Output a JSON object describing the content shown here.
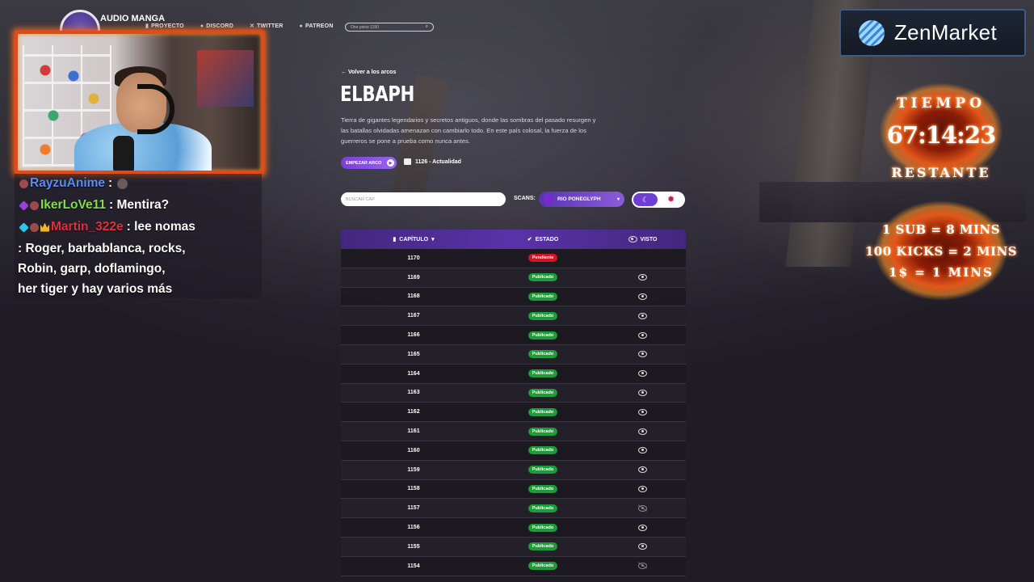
{
  "nav": {
    "logo": "AUDIO MANGA",
    "items": [
      {
        "label": "PROYECTO",
        "icon": "book-icon"
      },
      {
        "label": "DISCORD",
        "icon": "discord-icon"
      },
      {
        "label": "TWITTER",
        "icon": "x-icon"
      },
      {
        "label": "PATREON",
        "icon": "patreon-icon"
      }
    ],
    "search_value": "One piece 1150"
  },
  "chat": {
    "lines": [
      {
        "user": "RayzuAnime",
        "user_color": "#5b8df0",
        "message": ":"
      },
      {
        "user": "IkerLoVe11",
        "user_color": "#7fe04a",
        "message": ": Mentira?"
      },
      {
        "user": "Martin_322e",
        "user_color": "#e0303f",
        "message": ": lee nomas"
      },
      {
        "user": "",
        "user_color": "#ffffff",
        "message": ": Roger, barbablanca, rocks,"
      },
      {
        "user": "",
        "user_color": "#ffffff",
        "message": "Robin, garp, doflamingo,"
      },
      {
        "user": "",
        "user_color": "#ffffff",
        "message": "her tiger y hay varios más"
      }
    ]
  },
  "arc": {
    "back": "← Volver a los arcos",
    "title": "ELBAPH",
    "description": "Tierra de gigantes legendarios y secretos antiguos, donde las sombras del pasado resurgen y las batallas olvidadas amenazan con cambiarlo todo. En este país colosal, la fuerza de los guerreros se pone a prueba como nunca antes.",
    "start_button": "EMPEZAR ARCO",
    "range": "1126 - Actualidad"
  },
  "filters": {
    "search_placeholder": "BUSCAR CAP",
    "scans_label": "SCANS:",
    "scans_value": "RIO PONEGLYPH"
  },
  "table": {
    "headers": {
      "chapter": "CAPÍTULO",
      "status": "ESTADO",
      "seen": "VISTO"
    },
    "rows": [
      {
        "chapter": "1170",
        "status": "Pendiente",
        "status_color": "#d0142a",
        "seen": "none"
      },
      {
        "chapter": "1169",
        "status": "Publicado",
        "status_color": "#1f9b3a",
        "seen": "eye-icon"
      },
      {
        "chapter": "1168",
        "status": "Publicado",
        "status_color": "#1f9b3a",
        "seen": "eye-icon"
      },
      {
        "chapter": "1167",
        "status": "Publicado",
        "status_color": "#1f9b3a",
        "seen": "eye-icon"
      },
      {
        "chapter": "1166",
        "status": "Publicado",
        "status_color": "#1f9b3a",
        "seen": "eye-icon"
      },
      {
        "chapter": "1165",
        "status": "Publicado",
        "status_color": "#1f9b3a",
        "seen": "eye-icon"
      },
      {
        "chapter": "1164",
        "status": "Publicado",
        "status_color": "#1f9b3a",
        "seen": "eye-icon"
      },
      {
        "chapter": "1163",
        "status": "Publicado",
        "status_color": "#1f9b3a",
        "seen": "eye-icon"
      },
      {
        "chapter": "1162",
        "status": "Publicado",
        "status_color": "#1f9b3a",
        "seen": "eye-icon"
      },
      {
        "chapter": "1161",
        "status": "Publicado",
        "status_color": "#1f9b3a",
        "seen": "eye-icon"
      },
      {
        "chapter": "1160",
        "status": "Publicado",
        "status_color": "#1f9b3a",
        "seen": "eye-icon"
      },
      {
        "chapter": "1159",
        "status": "Publicado",
        "status_color": "#1f9b3a",
        "seen": "eye-icon"
      },
      {
        "chapter": "1158",
        "status": "Publicado",
        "status_color": "#1f9b3a",
        "seen": "eye-icon"
      },
      {
        "chapter": "1157",
        "status": "Publicado",
        "status_color": "#1f9b3a",
        "seen": "eye-off-icon"
      },
      {
        "chapter": "1156",
        "status": "Publicado",
        "status_color": "#1f9b3a",
        "seen": "eye-icon"
      },
      {
        "chapter": "1155",
        "status": "Publicado",
        "status_color": "#1f9b3a",
        "seen": "eye-icon"
      },
      {
        "chapter": "1154",
        "status": "Publicado",
        "status_color": "#1f9b3a",
        "seen": "eye-off-icon"
      }
    ]
  },
  "overlay": {
    "sponsor": "ZenMarket",
    "timer_label": "TIEMPO",
    "timer_value": "67:14:23",
    "timer_sub": "RESTANTE",
    "rules": [
      "1 SUB = 8 MINS",
      "100 KICKS = 2 MINS",
      "1$ = 1 MINS"
    ]
  }
}
